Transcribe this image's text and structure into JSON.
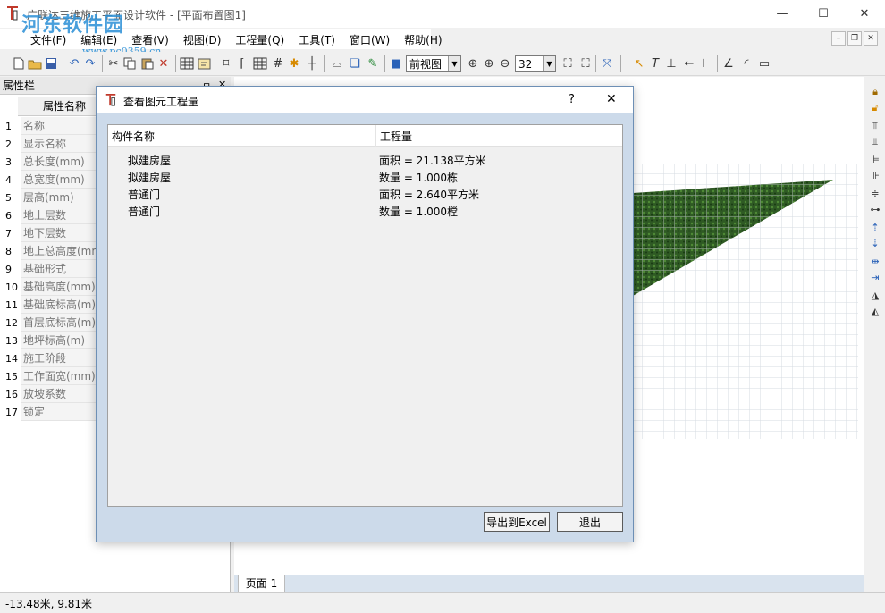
{
  "window": {
    "title": "广联达三维施工平面设计软件 - [平面布置图1]",
    "watermark": "河东软件园",
    "watermark_url": "www.pc0359.cn",
    "controls": {
      "minimize": "—",
      "maximize": "☐",
      "close": "✕"
    }
  },
  "menu": [
    "文件(F)",
    "编辑(E)",
    "查看(V)",
    "视图(D)",
    "工程量(Q)",
    "工具(T)",
    "窗口(W)",
    "帮助(H)"
  ],
  "mdi_controls": {
    "minimize": "–",
    "restore": "❐",
    "close": "✕"
  },
  "toolbar": {
    "view_combo": "前视图",
    "zoom_combo": "32"
  },
  "property_panel": {
    "title": "属性栏",
    "pin": "ㅁ",
    "close": "✕",
    "column_header": "属性名称",
    "rows": [
      {
        "num": "1",
        "label": "名称"
      },
      {
        "num": "2",
        "label": "显示名称"
      },
      {
        "num": "3",
        "label": "总长度(mm)"
      },
      {
        "num": "4",
        "label": "总宽度(mm)"
      },
      {
        "num": "5",
        "label": "层高(mm)"
      },
      {
        "num": "6",
        "label": "地上层数"
      },
      {
        "num": "7",
        "label": "地下层数"
      },
      {
        "num": "8",
        "label": "地上总高度(mm"
      },
      {
        "num": "9",
        "label": "基础形式"
      },
      {
        "num": "10",
        "label": "基础高度(mm)"
      },
      {
        "num": "11",
        "label": "基础底标高(m)"
      },
      {
        "num": "12",
        "label": "首层底标高(m)"
      },
      {
        "num": "13",
        "label": "地坪标高(m)"
      },
      {
        "num": "14",
        "label": "施工阶段"
      },
      {
        "num": "15",
        "label": "工作面宽(mm)"
      },
      {
        "num": "16",
        "label": "放坡系数"
      },
      {
        "num": "17",
        "label": "锁定"
      }
    ]
  },
  "page_tab": "页面 1",
  "status": {
    "coords": "-13.48米, 9.81米"
  },
  "dialog": {
    "title": "查看图元工程量",
    "help": "?",
    "close": "✕",
    "columns": [
      "构件名称",
      "工程量"
    ],
    "rows": [
      {
        "name": "拟建房屋",
        "quantity": "面积 = 21.138平方米"
      },
      {
        "name": "拟建房屋",
        "quantity": "数量 = 1.000栋"
      },
      {
        "name": "普通门",
        "quantity": "面积 = 2.640平方米"
      },
      {
        "name": "普通门",
        "quantity": "数量 = 1.000樘"
      }
    ],
    "export_button": "导出到Excel",
    "exit_button": "退出"
  },
  "colors": {
    "dialog_bg": "#ccdaea",
    "grid_line": "#d6dbe2",
    "terrain": "#2f5a24",
    "watermark": "#2a8fd6"
  }
}
